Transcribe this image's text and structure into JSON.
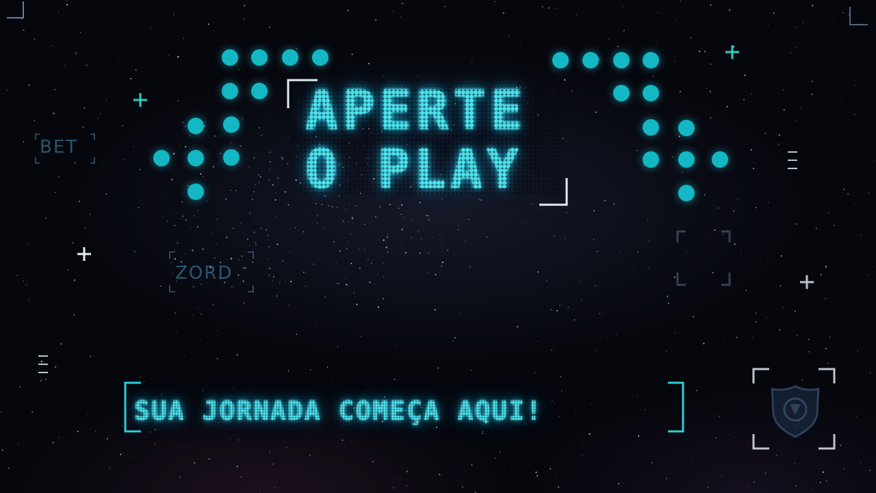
{
  "headline": {
    "line1": "APERTE",
    "line2": "O PLAY"
  },
  "tagline": "SUA JORNADA COMEÇA AQUI!",
  "brand": {
    "word1": "BET",
    "word2": "ZORD"
  },
  "colors": {
    "accent": "#4ae6f2",
    "dots": "#14b8c4",
    "background": "#06070d",
    "faint_label": "#4696be"
  },
  "icons": [
    "plus-icon",
    "bracket-corner-icon",
    "dash-stack-icon",
    "shield-logo-icon",
    "arrow-dots-icon"
  ]
}
